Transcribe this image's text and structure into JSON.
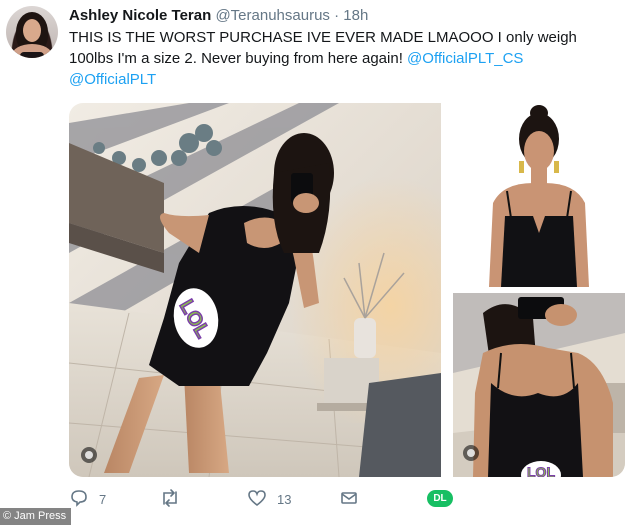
{
  "tweet": {
    "display_name": "Ashley Nicole Teran",
    "handle": "@Teranuhsaurus",
    "separator": "·",
    "timestamp": "18h",
    "text_plain": "THIS IS THE WORST PURCHASE IVE EVER MADE LMAOOO I only weigh 100lbs I'm a size 2. Never buying from here again! ",
    "mention_1": "@OfficialPLT_CS",
    "mention_2": "@OfficialPLT",
    "avatar_icon": "profile-photo",
    "media": [
      {
        "description_icon": "mirror-selfie-photo",
        "sticker_text": "LOL"
      },
      {
        "description_icon": "product-photo"
      },
      {
        "description_icon": "mirror-selfie-crop-photo",
        "sticker_text": "LOL"
      }
    ]
  },
  "actions": {
    "reply_icon": "reply-icon",
    "reply_count": "7",
    "retweet_icon": "retweet-icon",
    "like_icon": "heart-icon",
    "like_count": "13",
    "dm_icon": "envelope-icon",
    "dl_label": "DL"
  },
  "credit": "© Jam Press",
  "colors": {
    "text": "#14171a",
    "secondary": "#657786",
    "link": "#1da1f2",
    "dl_badge": "#17bf63",
    "sticker": "#7b3fa8",
    "sticker_text": "#8bc34a"
  }
}
